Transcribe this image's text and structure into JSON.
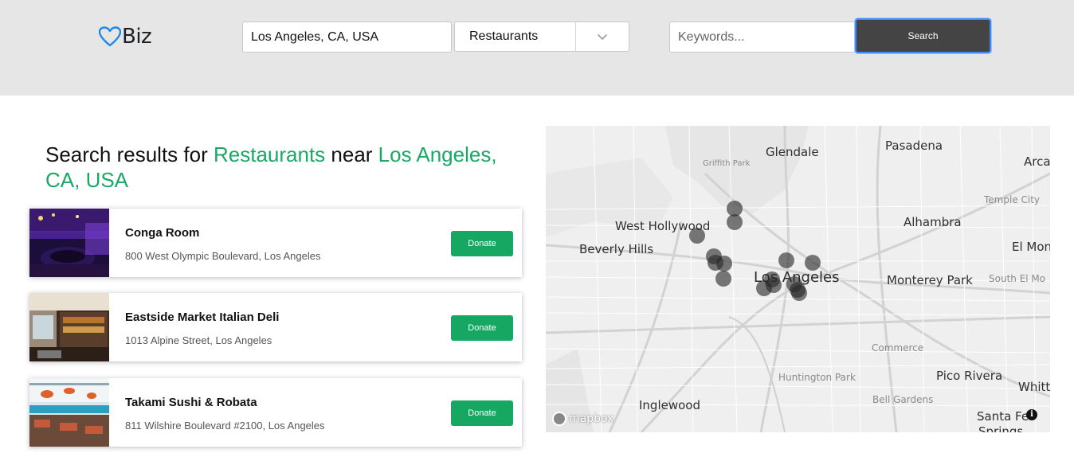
{
  "header": {
    "logo_text": "Biz",
    "location_value": "Los Angeles, CA, USA",
    "category_selected": "Restaurants",
    "keywords_placeholder": "Keywords...",
    "search_label": "Search"
  },
  "results": {
    "prefix": "Search results for ",
    "category": "Restaurants",
    "near": " near ",
    "location": "Los Angeles, CA, USA",
    "items": [
      {
        "name": "Conga Room",
        "address": "800 West Olympic Boulevard, Los Angeles",
        "donate_label": "Donate"
      },
      {
        "name": "Eastside Market Italian Deli",
        "address": "1013 Alpine Street, Los Angeles",
        "donate_label": "Donate"
      },
      {
        "name": "Takami Sushi & Robata",
        "address": "811 Wilshire Boulevard #2100, Los Angeles",
        "donate_label": "Donate"
      }
    ]
  },
  "map": {
    "labels": {
      "glendale": "Glendale",
      "pasadena": "Pasadena",
      "griffith": "Griffith Park",
      "arcadia": "Arcadi",
      "temple_city": "Temple City",
      "west_hollywood": "West Hollywood",
      "alhambra": "Alhambra",
      "beverly_hills": "Beverly Hills",
      "el_monte": "El Mon",
      "los_angeles": "Los Angeles",
      "monterey_park": "Monterey Park",
      "south_el_monte": "South El Mo",
      "commerce": "Commerce",
      "huntington_park": "Huntington Park",
      "pico_rivera": "Pico Rivera",
      "whittier": "Whitt",
      "inglewood": "Inglewood",
      "bell_gardens": "Bell Gardens",
      "santa_fe": "Santa Fe",
      "springs": "Springs"
    },
    "attribution": "mapbox",
    "info_glyph": "i"
  },
  "colors": {
    "header_bg": "#e6e6e6",
    "accent_green": "#1aa865",
    "search_btn_bg": "#444444",
    "donate_bg": "#16a862"
  },
  "icons": {
    "logo": "heart-icon",
    "dropdown": "chevron-down-icon",
    "info": "info-icon"
  }
}
